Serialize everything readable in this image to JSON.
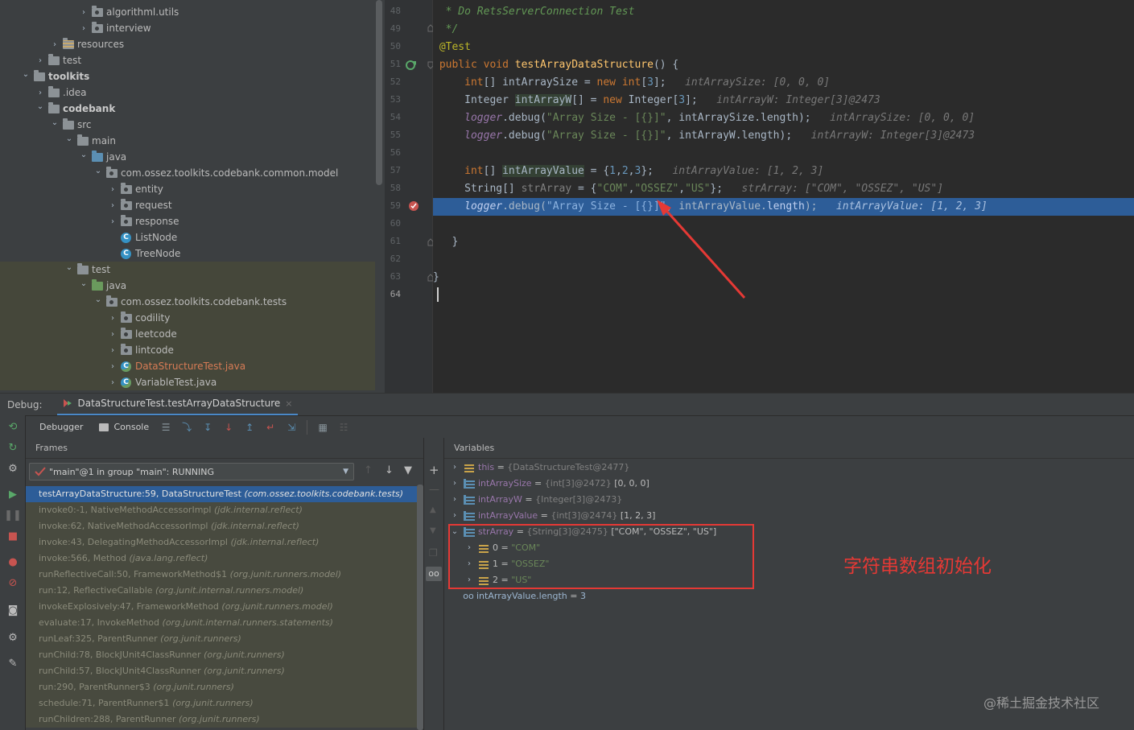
{
  "project_tree": {
    "rows": [
      {
        "label": "algorithml.utils",
        "indent": 6,
        "icon": "package",
        "chev": "›"
      },
      {
        "label": "interview",
        "indent": 6,
        "icon": "package",
        "chev": "›"
      },
      {
        "label": "resources",
        "indent": 4,
        "icon": "resources",
        "chev": "›"
      },
      {
        "label": "test",
        "indent": 3,
        "icon": "folder",
        "chev": "›"
      },
      {
        "label": "toolkits",
        "indent": 2,
        "icon": "module",
        "chev": "⌄",
        "bold": true
      },
      {
        "label": ".idea",
        "indent": 3,
        "icon": "folder",
        "chev": "›"
      },
      {
        "label": "codebank",
        "indent": 3,
        "icon": "module",
        "chev": "⌄",
        "bold": true
      },
      {
        "label": "src",
        "indent": 4,
        "icon": "folder",
        "chev": "⌄"
      },
      {
        "label": "main",
        "indent": 5,
        "icon": "folder",
        "chev": "⌄"
      },
      {
        "label": "java",
        "indent": 6,
        "icon": "source",
        "chev": "⌄"
      },
      {
        "label": "com.ossez.toolkits.codebank.common.model",
        "indent": 7,
        "icon": "package",
        "chev": "⌄"
      },
      {
        "label": "entity",
        "indent": 8,
        "icon": "package",
        "chev": "›"
      },
      {
        "label": "request",
        "indent": 8,
        "icon": "package",
        "chev": "›"
      },
      {
        "label": "response",
        "indent": 8,
        "icon": "package",
        "chev": "›"
      },
      {
        "label": "ListNode",
        "indent": 8,
        "icon": "class",
        "chev": ""
      },
      {
        "label": "TreeNode",
        "indent": 8,
        "icon": "class",
        "chev": ""
      },
      {
        "label": "test",
        "indent": 5,
        "icon": "folder",
        "chev": "⌄",
        "test": true
      },
      {
        "label": "java",
        "indent": 6,
        "icon": "testsource",
        "chev": "⌄",
        "test": true
      },
      {
        "label": "com.ossez.toolkits.codebank.tests",
        "indent": 7,
        "icon": "package",
        "chev": "⌄",
        "test": true
      },
      {
        "label": "codility",
        "indent": 8,
        "icon": "package",
        "chev": "›",
        "test": true
      },
      {
        "label": "leetcode",
        "indent": 8,
        "icon": "package",
        "chev": "›",
        "test": true
      },
      {
        "label": "lintcode",
        "indent": 8,
        "icon": "package",
        "chev": "›",
        "test": true
      },
      {
        "label": "DataStructureTest.java",
        "indent": 8,
        "icon": "testclass",
        "chev": "›",
        "test": true,
        "red": true
      },
      {
        "label": "VariableTest.java",
        "indent": 8,
        "icon": "testclass",
        "chev": "›",
        "test": true
      }
    ]
  },
  "editor": {
    "line_numbers": [
      "48",
      "49",
      "50",
      "51",
      "52",
      "53",
      "54",
      "55",
      "56",
      "57",
      "58",
      "59",
      "60",
      "61",
      "62",
      "63",
      "64"
    ],
    "current_line": "64",
    "breakpoint_line": "59"
  },
  "debug": {
    "label": "Debug:",
    "session_tab": "DataStructureTest.testArrayDataStructure",
    "tab_debugger": "Debugger",
    "tab_console": "Console",
    "frames_title": "Frames",
    "variables_title": "Variables",
    "thread_select": "\"main\"@1 in group \"main\": RUNNING",
    "frames": [
      {
        "method": "testArrayDataStructure:59, DataStructureTest",
        "pkg": "(com.ossez.toolkits.codebank.tests)",
        "selected": true
      },
      {
        "method": "invoke0:-1, NativeMethodAccessorImpl",
        "pkg": "(jdk.internal.reflect)"
      },
      {
        "method": "invoke:62, NativeMethodAccessorImpl",
        "pkg": "(jdk.internal.reflect)"
      },
      {
        "method": "invoke:43, DelegatingMethodAccessorImpl",
        "pkg": "(jdk.internal.reflect)"
      },
      {
        "method": "invoke:566, Method",
        "pkg": "(java.lang.reflect)"
      },
      {
        "method": "runReflectiveCall:50, FrameworkMethod$1",
        "pkg": "(org.junit.runners.model)"
      },
      {
        "method": "run:12, ReflectiveCallable",
        "pkg": "(org.junit.internal.runners.model)"
      },
      {
        "method": "invokeExplosively:47, FrameworkMethod",
        "pkg": "(org.junit.runners.model)"
      },
      {
        "method": "evaluate:17, InvokeMethod",
        "pkg": "(org.junit.internal.runners.statements)"
      },
      {
        "method": "runLeaf:325, ParentRunner",
        "pkg": "(org.junit.runners)"
      },
      {
        "method": "runChild:78, BlockJUnit4ClassRunner",
        "pkg": "(org.junit.runners)"
      },
      {
        "method": "runChild:57, BlockJUnit4ClassRunner",
        "pkg": "(org.junit.runners)"
      },
      {
        "method": "run:290, ParentRunner$3",
        "pkg": "(org.junit.runners)"
      },
      {
        "method": "schedule:71, ParentRunner$1",
        "pkg": "(org.junit.runners)"
      },
      {
        "method": "runChildren:288, ParentRunner",
        "pkg": "(org.junit.runners)"
      }
    ],
    "variables": [
      {
        "name": "this",
        "type": "{DataStructureTest@2477}",
        "value": "",
        "icon": "field",
        "chev": "›",
        "indent": 0
      },
      {
        "name": "intArraySize",
        "type": "{int[3]@2472}",
        "value": "[0, 0, 0]",
        "icon": "array",
        "chev": "›",
        "indent": 0
      },
      {
        "name": "intArrayW",
        "type": "{Integer[3]@2473}",
        "value": "",
        "icon": "array",
        "chev": "›",
        "indent": 0
      },
      {
        "name": "intArrayValue",
        "type": "{int[3]@2474}",
        "value": "[1, 2, 3]",
        "icon": "array",
        "chev": "›",
        "indent": 0
      },
      {
        "name": "strArray",
        "type": "{String[3]@2475}",
        "value": "[\"COM\", \"OSSEZ\", \"US\"]",
        "icon": "array",
        "chev": "⌄",
        "indent": 0
      },
      {
        "name": "0",
        "type": "",
        "value": "\"COM\"",
        "icon": "field",
        "chev": "›",
        "indent": 1,
        "str": true
      },
      {
        "name": "1",
        "type": "",
        "value": "\"OSSEZ\"",
        "icon": "field",
        "chev": "›",
        "indent": 1,
        "str": true
      },
      {
        "name": "2",
        "type": "",
        "value": "\"US\"",
        "icon": "field",
        "chev": "›",
        "indent": 1,
        "str": true
      },
      {
        "name": "intArrayValue.length",
        "type": "",
        "value": "3",
        "icon": "watch",
        "chev": "",
        "indent": 0,
        "watch": true
      }
    ]
  },
  "annotation": {
    "text": "字符串数组初始化",
    "color": "#e53935"
  },
  "watermark": "@稀土掘金技术社区",
  "colors": {
    "selection": "#2d5d98",
    "annotation_box": "#e53935"
  }
}
